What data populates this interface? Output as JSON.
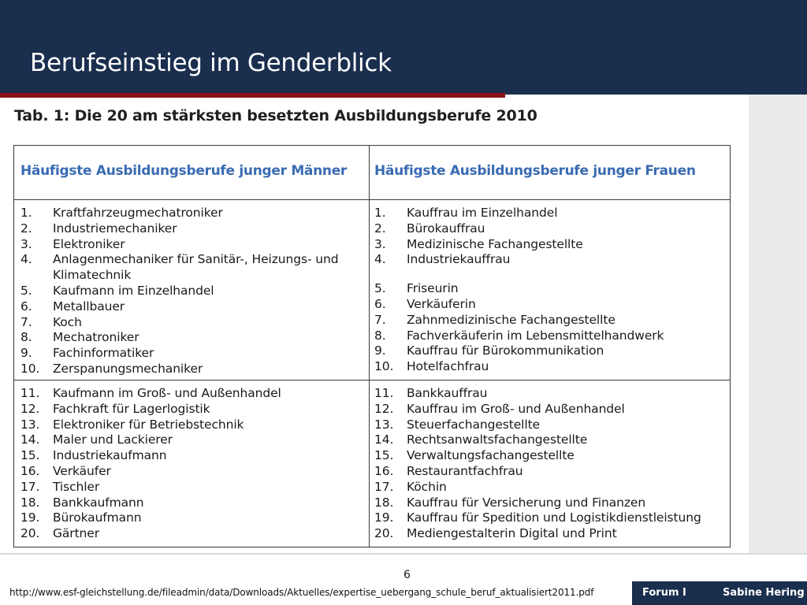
{
  "slide": {
    "title": "Berufseinstieg im Genderblick",
    "page_number": "6",
    "source_url": "http://www.esf-gleichstellung.de/fileadmin/data/Downloads/Aktuelles/expertise_uebergang_schule_beruf_aktualisiert2011.pdf",
    "footer_left": "Forum I",
    "footer_right": "Sabine Hering"
  },
  "table": {
    "title": "Tab. 1: Die 20 am stärksten besetzten Ausbildungsberufe 2010",
    "men_header": "Häufigste Ausbildungsberufe junger Männer",
    "women_header": "Häufigste Ausbildungsberufe junger Frauen",
    "men_top10": [
      {
        "n": "1.",
        "label": "Kraftfahrzeugmechatroniker"
      },
      {
        "n": "2.",
        "label": "Industriemechaniker"
      },
      {
        "n": "3.",
        "label": "Elektroniker"
      },
      {
        "n": "4.",
        "label": "Anlagenmechaniker für Sanitär-, Heizungs- und Klimatechnik"
      },
      {
        "n": "5.",
        "label": "Kaufmann im Einzelhandel"
      },
      {
        "n": "6.",
        "label": "Metallbauer"
      },
      {
        "n": "7.",
        "label": "Koch"
      },
      {
        "n": "8.",
        "label": "Mechatroniker"
      },
      {
        "n": "9.",
        "label": "Fachinformatiker"
      },
      {
        "n": "10.",
        "label": "Zerspanungsmechaniker"
      }
    ],
    "women_top10": [
      {
        "n": "1.",
        "label": "Kauffrau im Einzelhandel"
      },
      {
        "n": "2.",
        "label": "Bürokauffrau"
      },
      {
        "n": "3.",
        "label": "Medizinische Fachangestellte"
      },
      {
        "n": "4.",
        "label": "Industriekauffrau"
      },
      {
        "n": "5.",
        "label": "Friseurin"
      },
      {
        "n": "6.",
        "label": "Verkäuferin"
      },
      {
        "n": "7.",
        "label": "Zahnmedizinische Fachangestellte"
      },
      {
        "n": "8.",
        "label": "Fachverkäuferin im Lebensmittelhandwerk"
      },
      {
        "n": "9.",
        "label": "Kauffrau für Bürokommunikation"
      },
      {
        "n": "10.",
        "label": "Hotelfachfrau"
      }
    ],
    "men_11_20": [
      {
        "n": "11.",
        "label": "Kaufmann im Groß- und Außenhandel"
      },
      {
        "n": "12.",
        "label": "Fachkraft für Lagerlogistik"
      },
      {
        "n": "13.",
        "label": "Elektroniker für Betriebstechnik"
      },
      {
        "n": "14.",
        "label": "Maler und Lackierer"
      },
      {
        "n": "15.",
        "label": "Industriekaufmann"
      },
      {
        "n": "16.",
        "label": "Verkäufer"
      },
      {
        "n": "17.",
        "label": "Tischler"
      },
      {
        "n": "18.",
        "label": "Bankkaufmann"
      },
      {
        "n": "19.",
        "label": "Bürokaufmann"
      },
      {
        "n": "20.",
        "label": "Gärtner"
      }
    ],
    "women_11_20": [
      {
        "n": "11.",
        "label": "Bankkauffrau"
      },
      {
        "n": "12.",
        "label": "Kauffrau im Groß- und Außenhandel"
      },
      {
        "n": "13.",
        "label": "Steuerfachangestellte"
      },
      {
        "n": "14.",
        "label": "Rechtsanwaltsfachangestellte"
      },
      {
        "n": "15.",
        "label": "Verwaltungsfachangestellte"
      },
      {
        "n": "16.",
        "label": "Restaurantfachfrau"
      },
      {
        "n": "17.",
        "label": "Köchin"
      },
      {
        "n": "18.",
        "label": "Kauffrau für Versicherung und Finanzen"
      },
      {
        "n": "19.",
        "label": "Kauffrau für Spedition und Logistikdienstleistung"
      },
      {
        "n": "20.",
        "label": "Mediengestalterin Digital und Print"
      }
    ]
  },
  "colors": {
    "header_bg": "#1a2e4e",
    "accent_red": "#8b1218",
    "column_header_blue": "#3a6bb3"
  }
}
